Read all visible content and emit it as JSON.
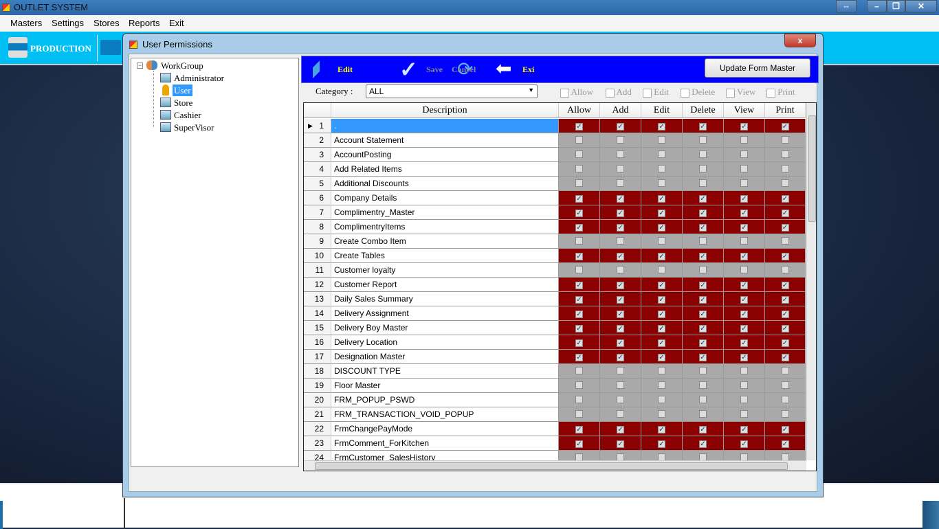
{
  "app": {
    "title": "OUTLET SYSTEM"
  },
  "menu": [
    "Masters",
    "Settings",
    "Stores",
    "Reports",
    "Exit"
  ],
  "ribbon": {
    "production": "PRODUCTION"
  },
  "dialog": {
    "title": "User Permissions",
    "close": "x"
  },
  "tree": {
    "root": "WorkGroup",
    "children": [
      "Administrator",
      "User",
      "Store",
      "Cashier",
      "SuperVisor"
    ],
    "selected": "User"
  },
  "toolbar": {
    "edit": "Edit",
    "save": "Save",
    "cancel": "Cancel",
    "exit": "Exi",
    "update": "Update Form Master"
  },
  "filter": {
    "category_label": "Category :",
    "category_value": "ALL",
    "checks": [
      "Allow",
      "Add",
      "Edit",
      "Delete",
      "View",
      "Print"
    ]
  },
  "colors": {
    "checked_row": "#8b0000",
    "unchecked_row": "#a9a9a9",
    "toolbar": "#0000ff",
    "ribbon": "#00bff3"
  },
  "grid": {
    "columns": [
      "Description",
      "Allow",
      "Add",
      "Edit",
      "Delete",
      "View",
      "Print"
    ],
    "rows": [
      {
        "n": "1",
        "desc": ".",
        "checked": true,
        "current": true
      },
      {
        "n": "2",
        "desc": "Account Statement",
        "checked": false
      },
      {
        "n": "3",
        "desc": "AccountPosting",
        "checked": false
      },
      {
        "n": "4",
        "desc": "Add Related Items",
        "checked": false
      },
      {
        "n": "5",
        "desc": "Additional Discounts",
        "checked": false
      },
      {
        "n": "6",
        "desc": "Company Details",
        "checked": true
      },
      {
        "n": "7",
        "desc": "Complimentry_Master",
        "checked": true
      },
      {
        "n": "8",
        "desc": "ComplimentryItems",
        "checked": true
      },
      {
        "n": "9",
        "desc": "Create  Combo Item",
        "checked": false
      },
      {
        "n": "10",
        "desc": "Create Tables",
        "checked": true
      },
      {
        "n": "11",
        "desc": "Customer loyalty",
        "checked": false
      },
      {
        "n": "12",
        "desc": "Customer Report",
        "checked": true
      },
      {
        "n": "13",
        "desc": "Daily Sales Summary",
        "checked": true
      },
      {
        "n": "14",
        "desc": "Delivery Assignment",
        "checked": true
      },
      {
        "n": "15",
        "desc": "Delivery Boy Master",
        "checked": true
      },
      {
        "n": "16",
        "desc": "Delivery Location",
        "checked": true
      },
      {
        "n": "17",
        "desc": "Designation Master",
        "checked": true
      },
      {
        "n": "18",
        "desc": "DISCOUNT TYPE",
        "checked": false
      },
      {
        "n": "19",
        "desc": "Floor Master",
        "checked": false
      },
      {
        "n": "20",
        "desc": "FRM_POPUP_PSWD",
        "checked": false
      },
      {
        "n": "21",
        "desc": "FRM_TRANSACTION_VOID_POPUP",
        "checked": false
      },
      {
        "n": "22",
        "desc": "FrmChangePayMode",
        "checked": true
      },
      {
        "n": "23",
        "desc": "FrmComment_ForKitchen",
        "checked": true
      },
      {
        "n": "24",
        "desc": "FrmCustomer_SalesHistory",
        "checked": false
      }
    ]
  }
}
